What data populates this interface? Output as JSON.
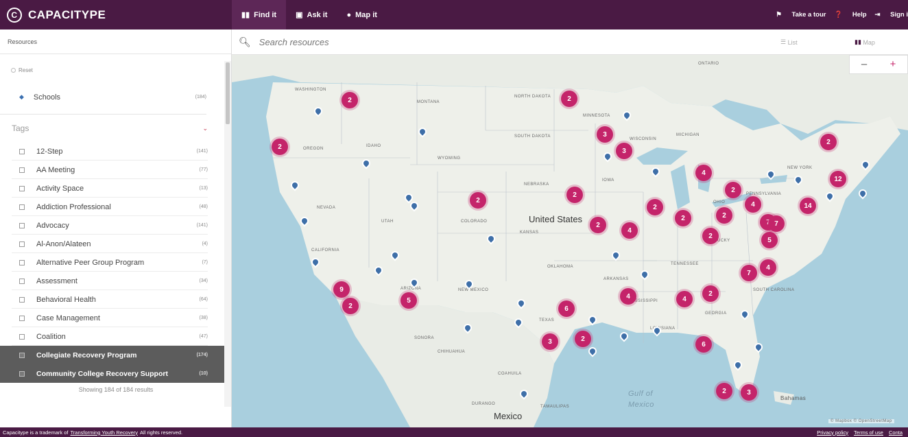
{
  "brand": {
    "logo_letter": "C",
    "name": "CAPACITYPE"
  },
  "nav": {
    "tabs": [
      {
        "icon": "map-icon",
        "label": "Find it"
      },
      {
        "icon": "chat-icon",
        "label": "Ask it"
      },
      {
        "icon": "pin-icon",
        "label": "Map it"
      }
    ],
    "tour": "Take a tour",
    "help": "Help",
    "signin": "Sign i"
  },
  "sidebar": {
    "header": "Resources",
    "reset": "Reset",
    "schools": {
      "label": "Schools",
      "count": "(184)"
    },
    "tags_header": "Tags",
    "tags": [
      {
        "label": "12-Step",
        "count": "(141)"
      },
      {
        "label": "AA Meeting",
        "count": "(77)"
      },
      {
        "label": "Activity Space",
        "count": "(13)"
      },
      {
        "label": "Addiction Professional",
        "count": "(48)"
      },
      {
        "label": "Advocacy",
        "count": "(141)"
      },
      {
        "label": "Al-Anon/Alateen",
        "count": "(4)"
      },
      {
        "label": "Alternative Peer Group Program",
        "count": "(7)"
      },
      {
        "label": "Assessment",
        "count": "(34)"
      },
      {
        "label": "Behavioral Health",
        "count": "(64)"
      },
      {
        "label": "Case Management",
        "count": "(38)"
      },
      {
        "label": "Coalition",
        "count": "(47)"
      },
      {
        "label": "Collegiate Recovery Program",
        "count": "(174)"
      },
      {
        "label": "Community College Recovery Support",
        "count": "(10)"
      }
    ],
    "showing": "Showing 184 of 184 results"
  },
  "search": {
    "placeholder": "Search resources"
  },
  "view_toggle": {
    "list": "List",
    "map": "Map"
  },
  "zoom": {
    "out": "–",
    "in": "+"
  },
  "map": {
    "country_label": "United States",
    "mexico_label": "Mexico",
    "gulf_label": "Gulf of Mexico",
    "bahamas_label": "Bahamas",
    "state_labels": [
      "WASHINGTON",
      "MONTANA",
      "NORTH DAKOTA",
      "MINNESOTA",
      "OREGON",
      "IDAHO",
      "SOUTH DAKOTA",
      "WISCONSIN",
      "MICHIGAN",
      "WYOMING",
      "IOWA",
      "NEBRASKA",
      "NEW YORK",
      "PENNSYLVANIA",
      "NEVADA",
      "UTAH",
      "COLORADO",
      "KANSAS",
      "OHIO",
      "CALIFORNIA",
      "ARIZONA",
      "NEW MEXICO",
      "OKLAHOMA",
      "ARKANSAS",
      "TENNESSEE",
      "KENTUCKY",
      "TEXAS",
      "LOUISIANA",
      "MISSISSIPPI",
      "GEORGIA",
      "SOUTH CAROLINA",
      "ONTARIO",
      "SONORA",
      "CHIHUAHUA",
      "COAHUILA",
      "DURANGO",
      "TAMAULIPAS"
    ],
    "clusters": [
      "2",
      "2",
      "3",
      "3",
      "2",
      "4",
      "2",
      "12",
      "2",
      "4",
      "14",
      "2",
      "2",
      "2",
      "2",
      "2",
      "4",
      "2",
      "7",
      "7",
      "2",
      "5",
      "9",
      "2",
      "5",
      "4",
      "7",
      "4",
      "6",
      "2",
      "4",
      "6",
      "3",
      "2",
      "2",
      "3"
    ],
    "attribution": "© Mapbox © OpenStreetMap"
  },
  "footer": {
    "text_before": "Capacitype is a trademark of",
    "link": "Transforming Youth Recovery",
    "text_after": "All rights reserved.",
    "privacy": "Privacy policy",
    "terms": "Terms of use",
    "contact": "Conta"
  }
}
